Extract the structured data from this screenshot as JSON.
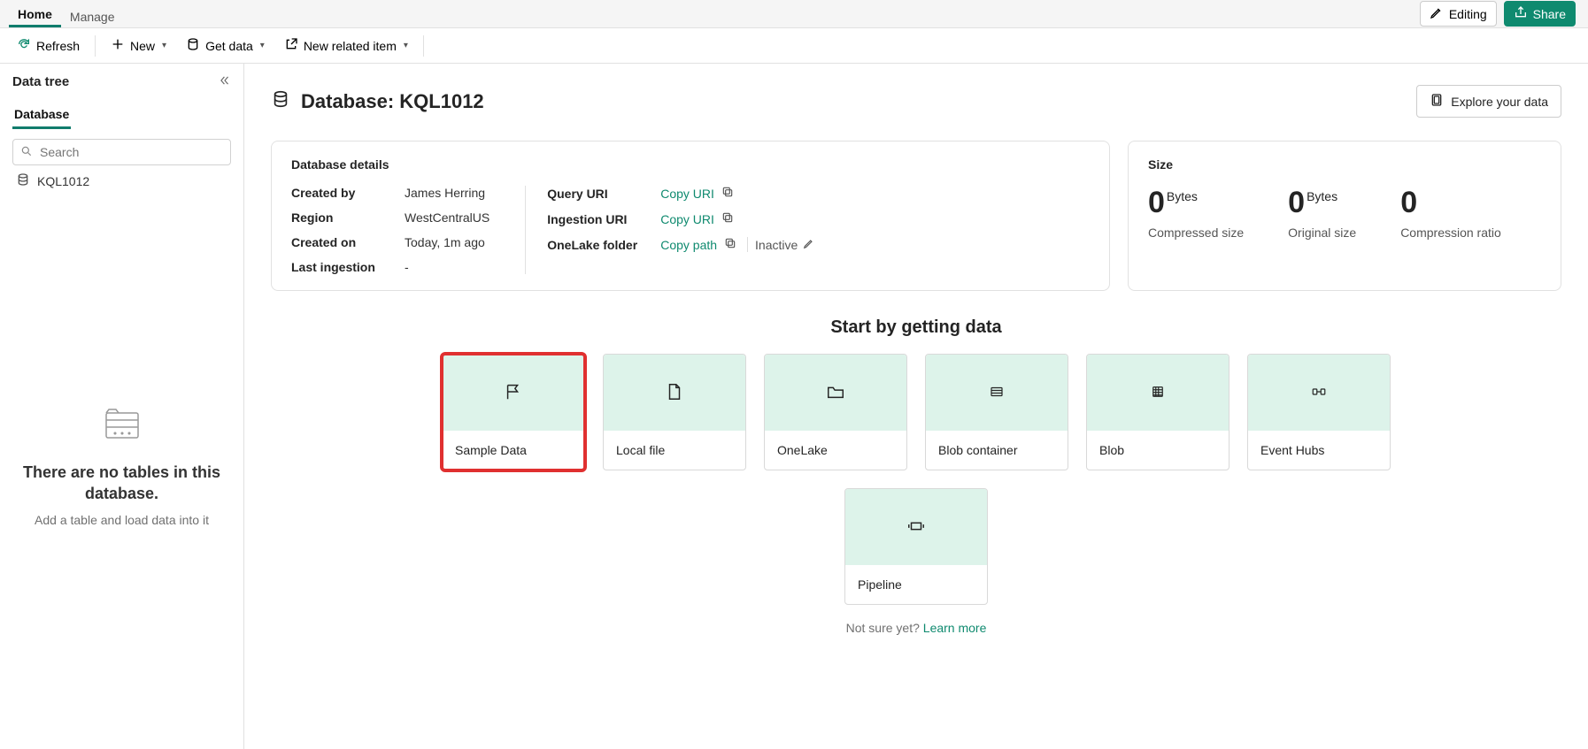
{
  "topTabs": {
    "home": "Home",
    "manage": "Manage"
  },
  "topRight": {
    "editing": "Editing",
    "share": "Share"
  },
  "toolbar": {
    "refresh": "Refresh",
    "new": "New",
    "getData": "Get data",
    "newRelated": "New related item"
  },
  "sidebar": {
    "title": "Data tree",
    "tab": "Database",
    "searchPlaceholder": "Search",
    "item": "KQL1012",
    "empty": {
      "title": "There are no tables in this database.",
      "sub": "Add a table and load data into it"
    }
  },
  "main": {
    "titlePrefix": "Database:",
    "dbName": "KQL1012",
    "explore": "Explore your data"
  },
  "details": {
    "title": "Database details",
    "createdByLabel": "Created by",
    "createdBy": "James Herring",
    "regionLabel": "Region",
    "region": "WestCentralUS",
    "createdOnLabel": "Created on",
    "createdOn": "Today, 1m ago",
    "lastIngestionLabel": "Last ingestion",
    "lastIngestion": "-",
    "queryUriLabel": "Query URI",
    "ingestionUriLabel": "Ingestion URI",
    "onelakeLabel": "OneLake folder",
    "copyUri": "Copy URI",
    "copyPath": "Copy path",
    "inactive": "Inactive"
  },
  "size": {
    "title": "Size",
    "compressedVal": "0",
    "compressedUnit": "Bytes",
    "compressedName": "Compressed size",
    "originalVal": "0",
    "originalUnit": "Bytes",
    "originalName": "Original size",
    "ratioVal": "0",
    "ratioName": "Compression ratio"
  },
  "getDataSection": {
    "title": "Start by getting data",
    "tiles": {
      "sample": "Sample Data",
      "local": "Local file",
      "onelake": "OneLake",
      "blobContainer": "Blob container",
      "blob": "Blob",
      "eventHubs": "Event Hubs",
      "pipeline": "Pipeline"
    },
    "notSure": "Not sure yet?",
    "learnMore": "Learn more"
  }
}
